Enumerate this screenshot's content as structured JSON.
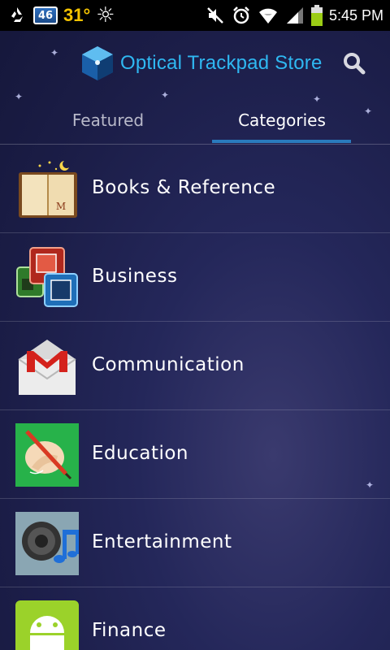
{
  "status_bar": {
    "notification_icons": [
      "recycle-icon",
      "calendar-icon"
    ],
    "calendar_number": "46",
    "temperature": "31°",
    "weather": "sun-icon",
    "system_icons": [
      "mute-icon",
      "alarm-icon",
      "wifi-icon",
      "signal-icon",
      "battery-icon"
    ],
    "time": "5:45 PM"
  },
  "app_bar": {
    "title": "Optical Trackpad Store",
    "title_color": "#2fb8f2",
    "search_icon": "search-icon"
  },
  "tabs": [
    {
      "label": "Featured",
      "selected": false
    },
    {
      "label": "Categories",
      "selected": true
    }
  ],
  "accent_color": "#2a7bbd",
  "categories": [
    {
      "label": "Books & Reference",
      "icon": "book-icon"
    },
    {
      "label": "Business",
      "icon": "business-windows-icon"
    },
    {
      "label": "Communication",
      "icon": "mail-icon"
    },
    {
      "label": "Education",
      "icon": "pencil-hand-icon"
    },
    {
      "label": "Entertainment",
      "icon": "speaker-music-icon"
    },
    {
      "label": "Finance",
      "icon": "android-icon"
    }
  ]
}
